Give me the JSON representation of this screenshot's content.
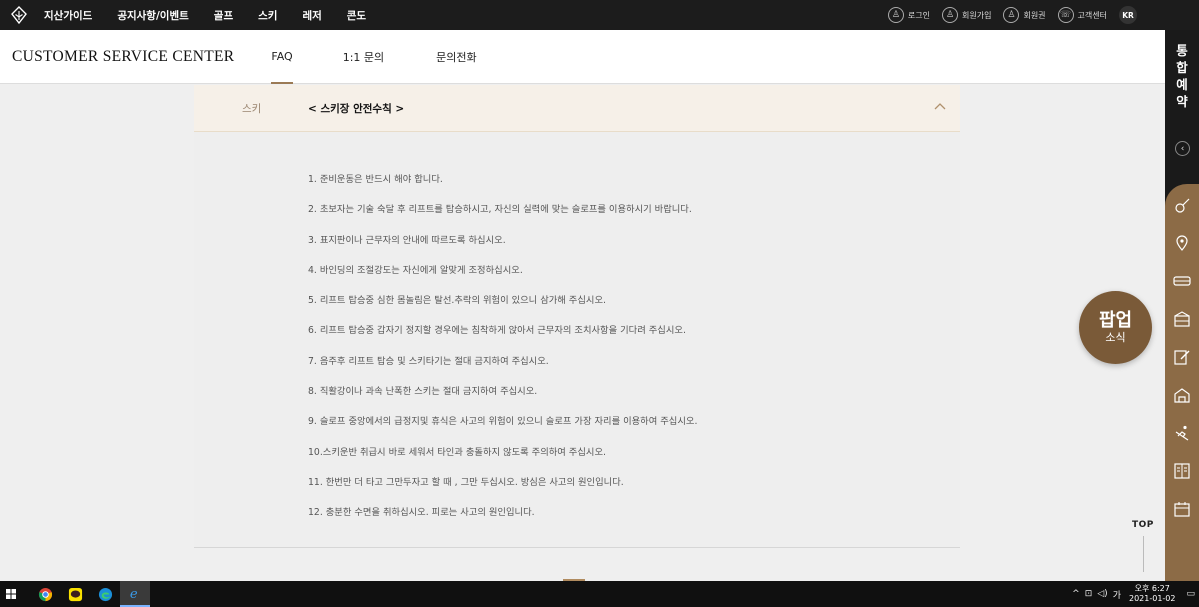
{
  "topnav": {
    "items": [
      "지산가이드",
      "공지사항/이벤트",
      "골프",
      "스키",
      "레저",
      "콘도"
    ],
    "util": [
      "로그인",
      "회원가입",
      "회원권",
      "고객센터"
    ],
    "lang": "KR"
  },
  "header": {
    "title": "CUSTOMER SERVICE CENTER",
    "tabs": [
      "FAQ",
      "1:1 문의",
      "문의전화"
    ],
    "active_tab": "FAQ"
  },
  "faq": {
    "category": "스키",
    "title": "< 스키장 안전수칙 >",
    "items": [
      "1. 준비운동은 반드시 해야 합니다.",
      "2. 초보자는 기술 숙달 후 리프트를 탑승하시고, 자신의 실력에 맞는 슬로프를 이용하시기 바랍니다.",
      "3. 표지판이나 근무자의 안내에 따르도록 하십시오.",
      "4. 바인딩의 조절강도는 자신에게 알맞게 조정하십시오.",
      "5. 리프트 탑승중 심한 몸놀림은 탈선.추락의 위험이 있으니 삼가해 주십시오.",
      "6. 리프트 탑승중 갑자기 정지할 경우에는 침착하게 앉아서 근무자의 조치사항을 기다려 주십시오.",
      "7. 음주후 리프트 탑승 및 스키타기는 절대 금지하여 주십시오.",
      "8. 직활강이나 과속 난폭한 스키는 절대 금지하여 주십시오.",
      "9. 슬로프 중앙에서의 급정지및 휴식은 사고의 위험이 있으니 슬로프 가장 자리를 이용하여 주십시오.",
      "10.스키운반 취급시 바로 세워서 타인과 충돌하지 않도록 주의하여 주십시오.",
      "11. 한번만 더 타고 그만두자고 할 때 , 그만 두십시오. 방심은 사고의 원인입니다.",
      "12. 충분한 수면을 취하십시오. 피로는 사고의 원인입니다."
    ]
  },
  "sidebar": {
    "vertical_title": [
      "통",
      "합",
      "예",
      "약"
    ],
    "icons": [
      "golf-icon",
      "location-pin-icon",
      "bus-icon",
      "condo-icon",
      "edit-icon",
      "building-icon",
      "ski-icon",
      "book-icon",
      "calendar-icon"
    ]
  },
  "popup": {
    "line1": "팝업",
    "line2": "소식"
  },
  "top_link": "TOP",
  "taskbar": {
    "time_ampm": "오후 6:27",
    "date": "2021-01-02"
  },
  "colors": {
    "accent": "#9b7a55",
    "sidebar_brown": "#8c6b46",
    "popup": "#7a5a38"
  }
}
